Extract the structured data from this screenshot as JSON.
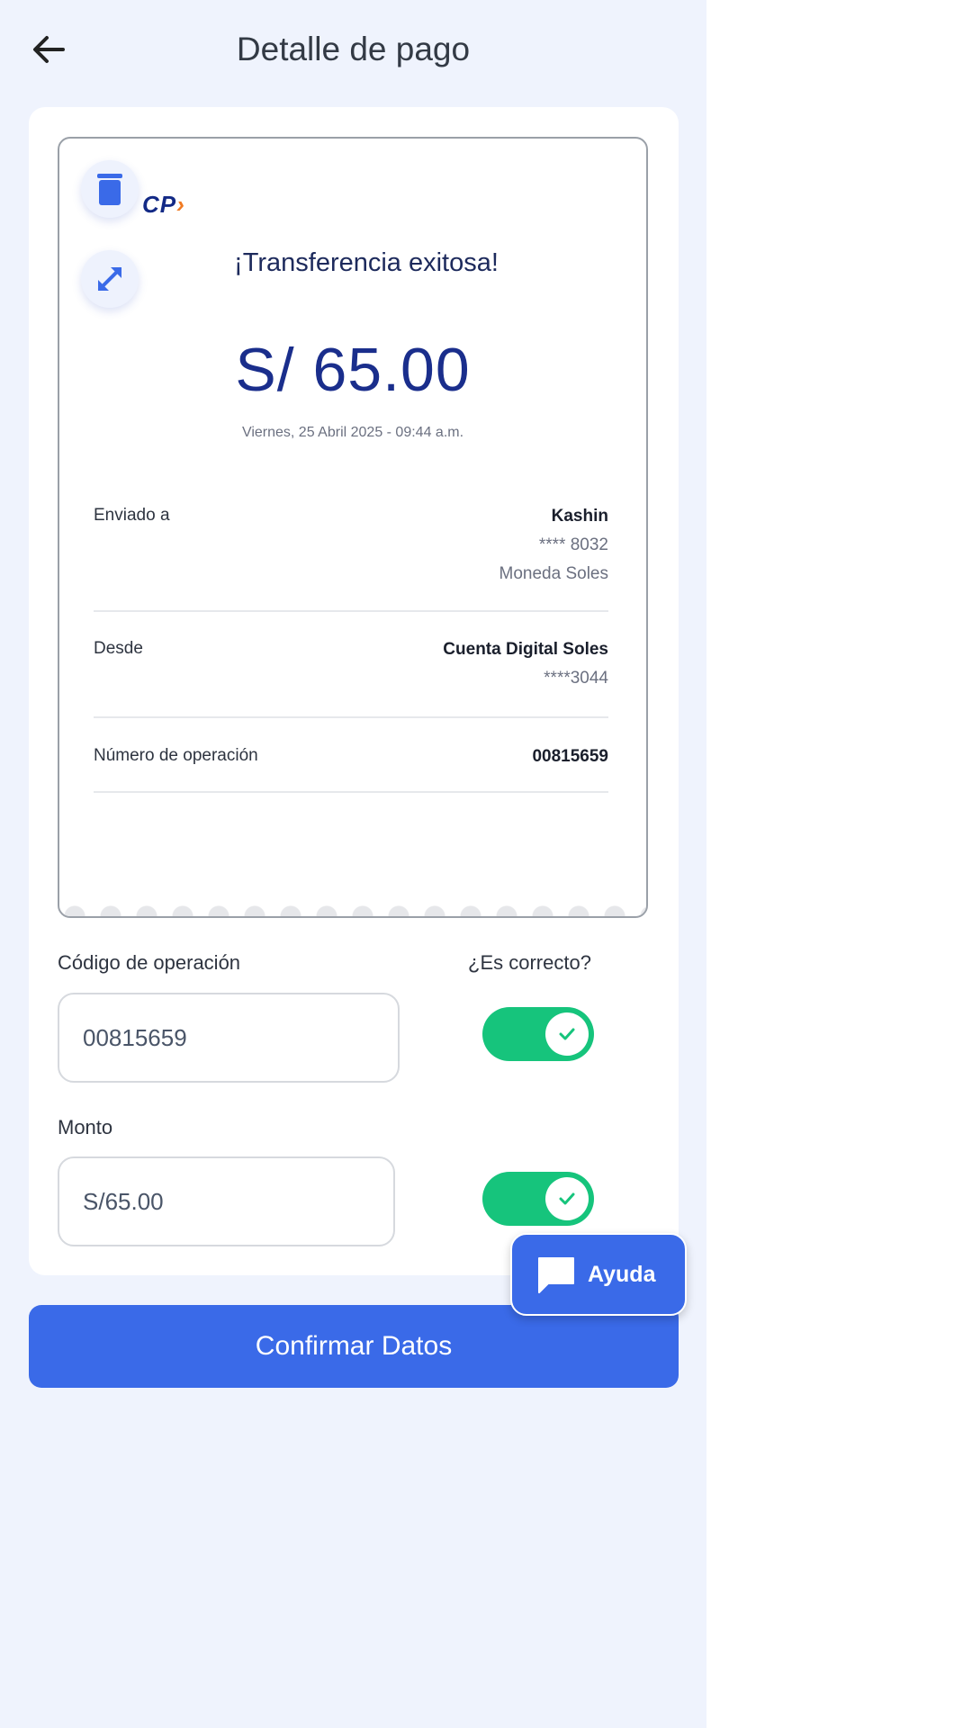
{
  "header": {
    "title": "Detalle de pago"
  },
  "receipt": {
    "logo_text": "CP",
    "logo_chevron": "›",
    "success_title": "¡Transferencia exitosa!",
    "amount": "S/ 65.00",
    "datetime": "Viernes, 25 Abril 2025 - 09:44 a.m.",
    "rows": {
      "sent_to": {
        "label": "Enviado a",
        "name": "Kashin",
        "account": "**** 8032",
        "currency": "Moneda Soles"
      },
      "from": {
        "label": "Desde",
        "account_name": "Cuenta Digital Soles",
        "account": "****3044"
      },
      "operation": {
        "label": "Número de operación",
        "value": "00815659"
      }
    }
  },
  "form": {
    "code_label": "Código de operación",
    "correct_label": "¿Es correcto?",
    "code_value": "00815659",
    "code_toggle_on": true,
    "amount_label": "Monto",
    "amount_value": "S/65.00",
    "amount_toggle_on": true
  },
  "help": {
    "label": "Ayuda"
  },
  "confirm": {
    "label": "Confirmar Datos"
  },
  "colors": {
    "primary": "#3a6ae8",
    "success": "#16c47c",
    "brand": "#132a86",
    "accent": "#f07a22"
  }
}
